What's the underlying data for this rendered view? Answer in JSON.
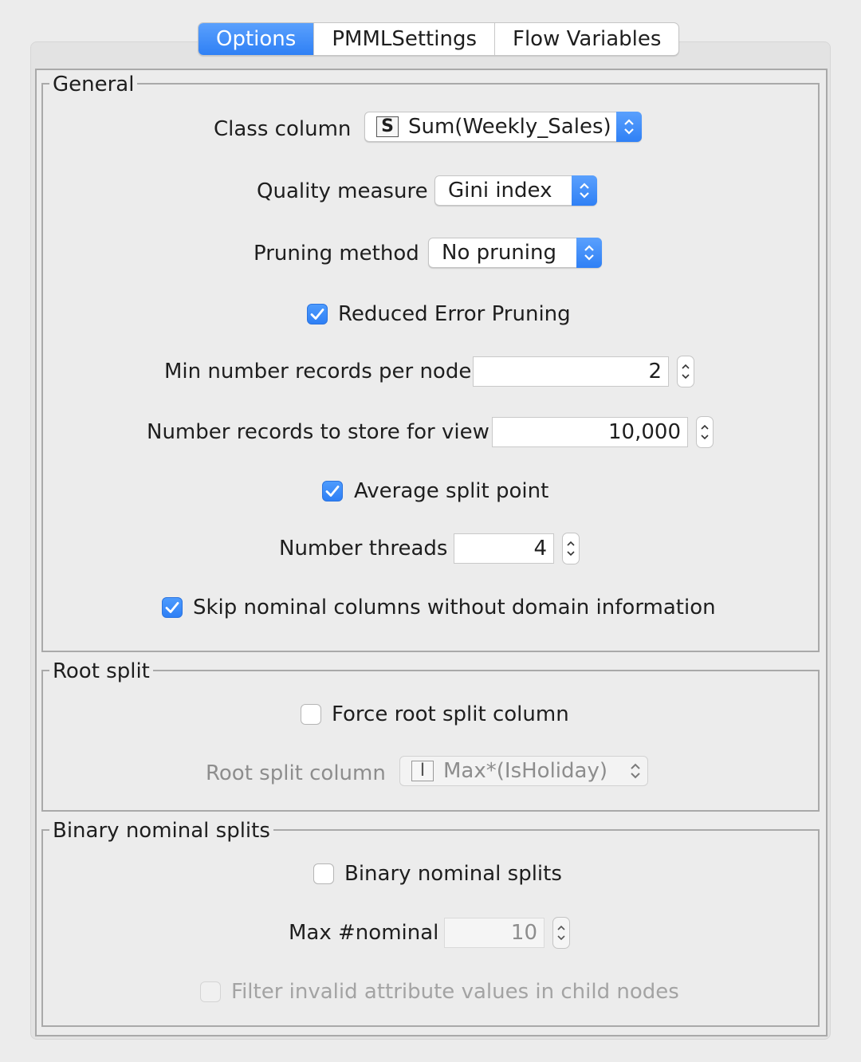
{
  "tabs": [
    {
      "label": "Options",
      "active": true
    },
    {
      "label": "PMMLSettings"
    },
    {
      "label": "Flow Variables"
    }
  ],
  "general": {
    "legend": "General",
    "class_column": {
      "label": "Class column",
      "type_icon": "S",
      "value": "Sum(Weekly_Sales)"
    },
    "quality_measure": {
      "label": "Quality measure",
      "value": "Gini index"
    },
    "pruning_method": {
      "label": "Pruning method",
      "value": "No pruning"
    },
    "reduced_error_pruning": {
      "label": "Reduced Error Pruning",
      "checked": true
    },
    "min_records": {
      "label": "Min number records per node",
      "value": "2"
    },
    "records_store": {
      "label": "Number records to store for view",
      "value": "10,000"
    },
    "average_split": {
      "label": "Average split point",
      "checked": true
    },
    "threads": {
      "label": "Number threads",
      "value": "4"
    },
    "skip_nominal": {
      "label": "Skip nominal columns without domain information",
      "checked": true
    }
  },
  "root_split": {
    "legend": "Root split",
    "force_root": {
      "label": "Force root split column",
      "checked": false
    },
    "root_column": {
      "label": "Root split column",
      "type_icon": "I",
      "value": "Max*(IsHoliday)",
      "disabled": true
    }
  },
  "binary_nominal": {
    "legend": "Binary nominal splits",
    "binary_splits": {
      "label": "Binary nominal splits",
      "checked": false
    },
    "max_nominal": {
      "label": "Max #nominal",
      "value": "10",
      "disabled": true
    },
    "filter_invalid": {
      "label": "Filter invalid attribute values in child nodes",
      "checked": false,
      "disabled": true
    }
  },
  "colors": {
    "accent": "#3f8efc",
    "disabled_text": "#8d8d8d"
  }
}
